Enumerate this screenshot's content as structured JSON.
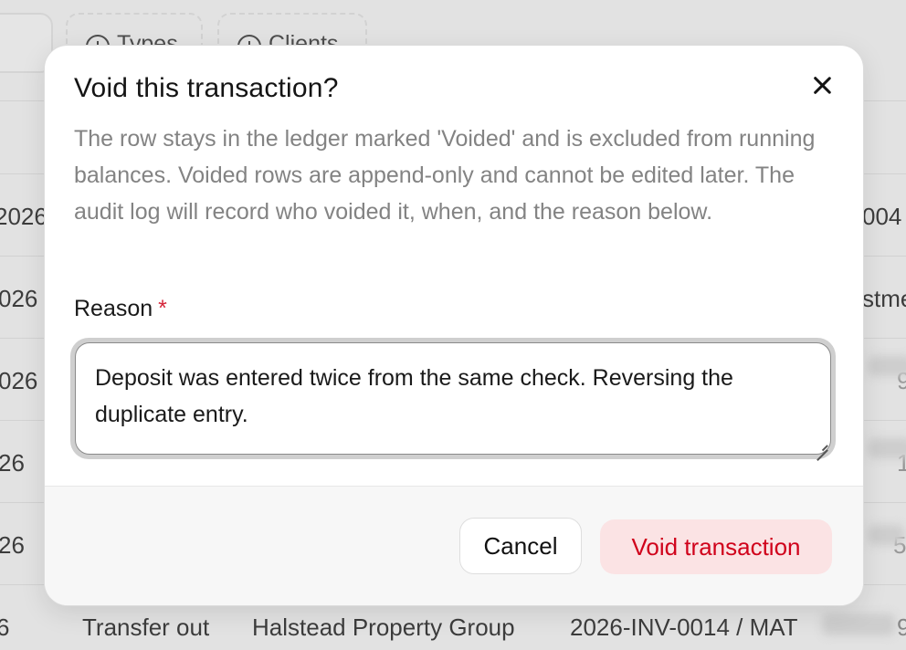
{
  "background": {
    "chips": [
      {
        "label": "Types"
      },
      {
        "label": "Clients"
      }
    ],
    "rows": [
      {
        "date": "2026",
        "right": "004"
      },
      {
        "date": "026",
        "right": "stme"
      },
      {
        "date": "026",
        "right": "9"
      },
      {
        "date": "26",
        "right": "1"
      },
      {
        "date": "26",
        "right": "5"
      },
      {
        "date": "6",
        "type": "Transfer out",
        "client": "Halstead Property Group",
        "reference": "2026-INV-0014 / MAT",
        "right": "9"
      }
    ]
  },
  "dialog": {
    "title": "Void this transaction?",
    "description": "The row stays in the ledger marked 'Voided' and is excluded from running balances. Voided rows are append-only and cannot be edited later. The audit log will record who voided it, when, and the reason below.",
    "reason_label": "Reason",
    "required_marker": "*",
    "reason_value": "Deposit was entered twice from the same check. Reversing the duplicate entry.",
    "cancel_label": "Cancel",
    "confirm_label": "Void transaction"
  },
  "colors": {
    "danger": "#d0021b",
    "danger_bg": "#fbe3e4",
    "muted_text": "#838383"
  }
}
